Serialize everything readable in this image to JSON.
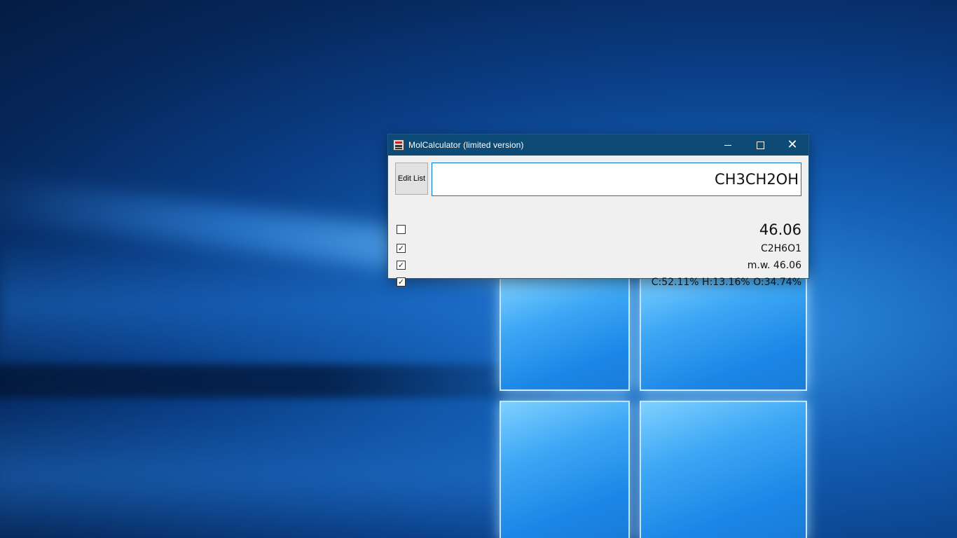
{
  "window": {
    "title": "MolCalculator (limited version)",
    "controls": {
      "minimize": "minimize",
      "maximize": "maximize",
      "close": "✕"
    }
  },
  "toolbar": {
    "edit_list_label": "Edit List"
  },
  "formula_input": {
    "value": "CH3CH2OH"
  },
  "results": [
    {
      "checked": false,
      "value": "46.06"
    },
    {
      "checked": true,
      "value": "C2H6O1"
    },
    {
      "checked": true,
      "value": "m.w. 46.06"
    },
    {
      "checked": true,
      "value": "C:52.11% H:13.16% O:34.74%"
    }
  ],
  "checkbox_glyph": "✓",
  "colors": {
    "title_bar": "#0e4a76",
    "window_body": "#f0f0f0",
    "input_border": "#0078d7"
  }
}
